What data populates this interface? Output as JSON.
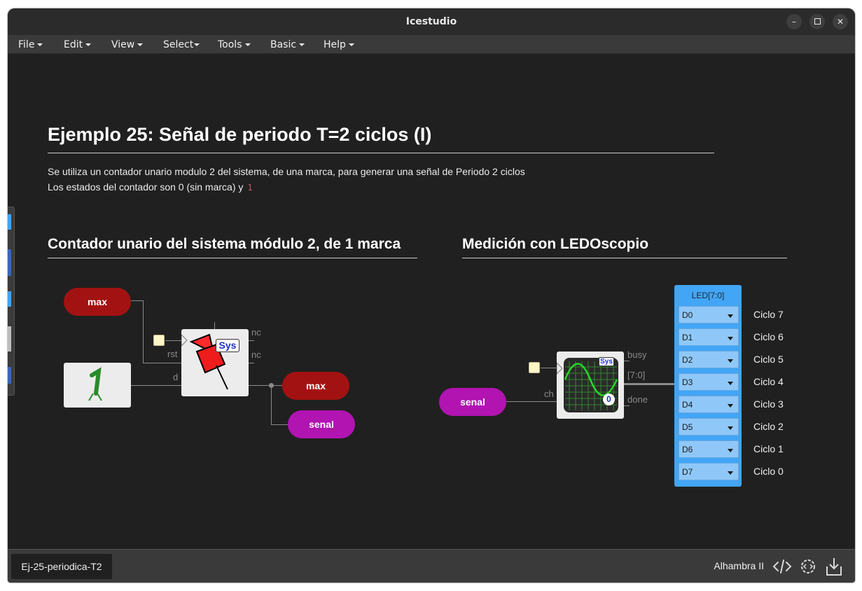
{
  "window": {
    "title": "Icestudio"
  },
  "menubar": {
    "items": [
      "File",
      "Edit",
      "View",
      "Select",
      "Tools",
      "Basic",
      "Help"
    ]
  },
  "main": {
    "title": "Ejemplo 25: Señal de periodo T=2 ciclos (I)",
    "desc_line1": "Se utiliza un contador unario modulo 2 del sistema, de una marca, para generar una señal de Periodo 2 ciclos",
    "desc_line2": "Los estados del contador son 0 (sin marca) y",
    "desc_code": "1",
    "section_left": "Contador unario del sistema módulo 2, de 1 marca",
    "section_right": "Medición con LEDOscopio"
  },
  "left_circuit": {
    "input_max": "max",
    "port_rst": "rst",
    "port_d": "d",
    "port_nc1": "nc",
    "port_nc2": "nc",
    "sys_label": "Sys",
    "out_max": "max",
    "out_senal": "senal"
  },
  "right_circuit": {
    "input_senal": "senal",
    "port_ch": "ch",
    "port_busy": "busy",
    "port_bus": "[7:0]",
    "port_done": "done",
    "sys_label": "Sys",
    "zero_label": "0",
    "led_title": "LED[7:0]",
    "led_options": [
      "D0",
      "D1",
      "D2",
      "D3",
      "D4",
      "D5",
      "D6",
      "D7"
    ],
    "ciclos": [
      "Ciclo 7",
      "Ciclo 6",
      "Ciclo 5",
      "Ciclo 4",
      "Ciclo 3",
      "Ciclo 2",
      "Ciclo 1",
      "Ciclo 0"
    ]
  },
  "statusbar": {
    "file_tab": "Ej-25-periodica-T2",
    "board": "Alhambra II"
  },
  "colors": {
    "red_port": "#a31212",
    "purple_port": "#b114b1",
    "led_block": "#42a5f5"
  }
}
